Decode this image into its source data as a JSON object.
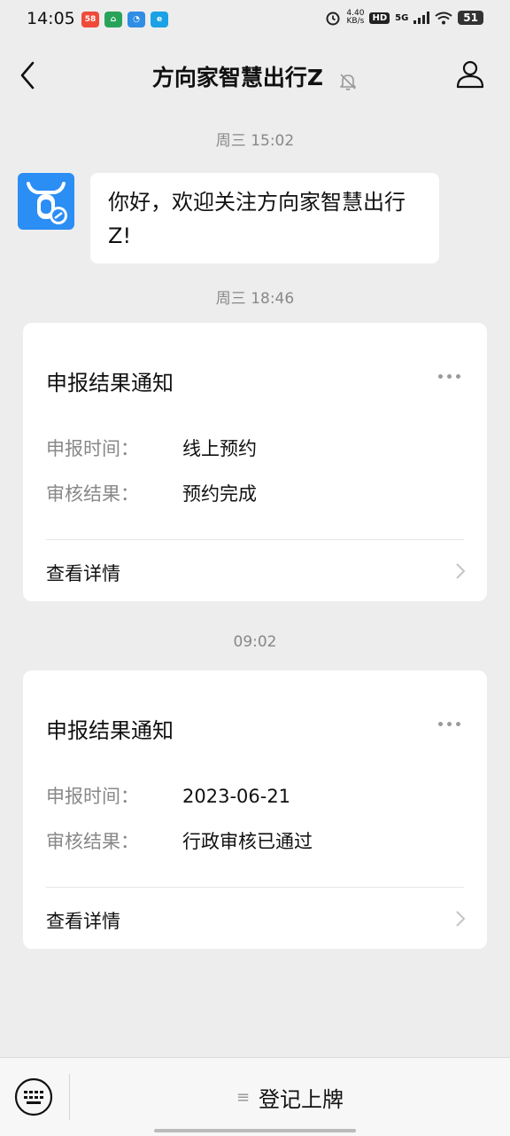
{
  "status_bar": {
    "time": "14:05",
    "net_speed": "4.40",
    "net_unit": "KB/s",
    "hd": "HD",
    "network": "5G",
    "battery": "51",
    "apps": [
      {
        "label": "58",
        "color": "#f04a3a"
      },
      {
        "label": "⌂",
        "color": "#2aa35a"
      },
      {
        "label": "◔",
        "color": "#2f8de4"
      },
      {
        "label": "e",
        "color": "#1aa1e6"
      }
    ]
  },
  "header": {
    "title": "方向家智慧出行Z"
  },
  "messages": {
    "ts1": "周三 15:02",
    "welcome": "你好，欢迎关注方向家智慧出行 Z!",
    "ts2": "周三 18:46",
    "ts3": "09:02"
  },
  "cards": [
    {
      "title": "申报结果通知",
      "rows": [
        {
          "label": "申报时间：",
          "value": "线上预约"
        },
        {
          "label": "审核结果：",
          "value": "预约完成"
        }
      ],
      "detail": "查看详情"
    },
    {
      "title": "申报结果通知",
      "rows": [
        {
          "label": "申报时间：",
          "value": "2023-06-21"
        },
        {
          "label": "审核结果：",
          "value": "行政审核已通过"
        }
      ],
      "detail": "查看详情"
    }
  ],
  "bottom_bar": {
    "menu_icon": "≡",
    "menu_label": "登记上牌"
  }
}
